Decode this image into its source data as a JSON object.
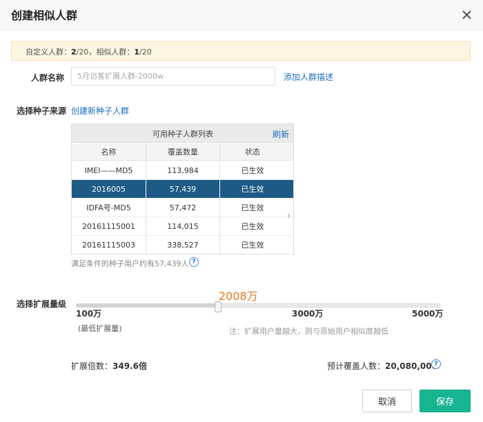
{
  "dialog": {
    "title": "创建相似人群",
    "close_icon": "close-icon"
  },
  "notice": {
    "custom_label": "自定义人群：",
    "custom_count": "2",
    "custom_total": "/20，",
    "similar_label": "相似人群：",
    "similar_count": "1",
    "similar_total": "/20"
  },
  "name_field": {
    "label": "人群名称",
    "placeholder": "5月访客扩展人群-2000w",
    "add_desc_link": "添加人群描述"
  },
  "seed": {
    "label": "选择种子来源",
    "create_link": "创建新种子人群",
    "table_title": "可用种子人群列表",
    "refresh": "刷新",
    "columns": [
      "名称",
      "覆盖数量",
      "状态"
    ],
    "rows": [
      {
        "name": "IMEI——MD5",
        "count": "113,984",
        "status": "已生效"
      },
      {
        "name": "2016005",
        "count": "57,439",
        "status": "已生效",
        "selected": true
      },
      {
        "name": "IDFA号-MD5",
        "count": "57,472",
        "status": "已生效"
      },
      {
        "name": "20161115001",
        "count": "114,015",
        "status": "已生效"
      },
      {
        "name": "20161115003",
        "count": "338,527",
        "status": "已生效"
      }
    ],
    "hint": "满足条件的种子用户约有57,439人",
    "help_icon": "?"
  },
  "expand": {
    "label": "选择扩展量级",
    "value_text": "2008万",
    "value": 2008,
    "min": 100,
    "max": 5000,
    "tick_min": "100万",
    "tick_mid": "3000万",
    "tick_max": "5000万",
    "min_note": "(最低扩展量)",
    "warning": "注：扩展用户量越大，则与原始用户相似度越低"
  },
  "footer": {
    "ratio_label": "扩展倍数：",
    "ratio_value": "349.6倍",
    "coverage_label": "预计覆盖人数：",
    "coverage_value": "20,080,000",
    "help_icon": "?",
    "cancel": "取消",
    "save": "保存"
  },
  "colors": {
    "accent": "#1c6fc2",
    "selected_row": "#1d5a86",
    "save_button": "#17b491",
    "slider_value": "#e07b16",
    "notice_bg": "#fdf5e1"
  }
}
